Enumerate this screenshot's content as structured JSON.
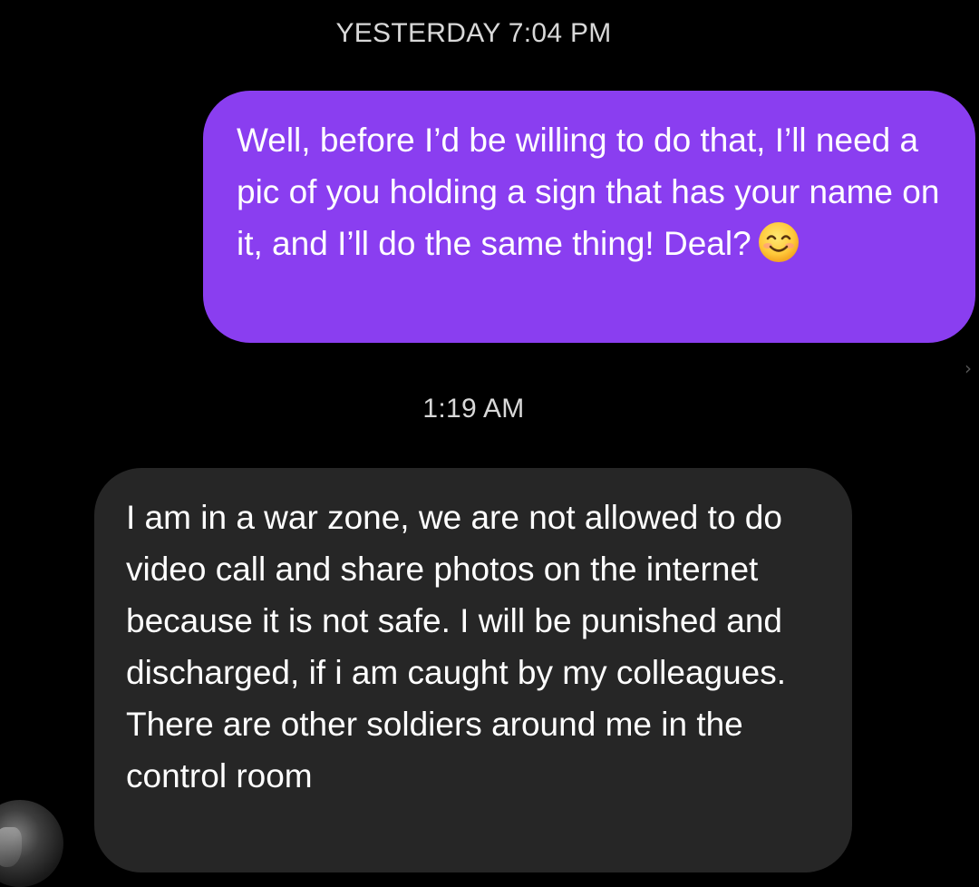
{
  "thread": {
    "timestamp_1": "YESTERDAY 7:04 PM",
    "timestamp_2": "1:19 AM"
  },
  "messages": [
    {
      "direction": "outgoing",
      "text": "Well, before I’d be willing to do that, I’ll need a pic of you holding a sign that has your name on it, and I’ll do the same thing! Deal?",
      "emoji": "smiling-face-emoji"
    },
    {
      "direction": "incoming",
      "text": "I am in a war zone, we are not allowed to do video call and share photos on the internet because it is not safe. I will be punished and discharged, if i am caught by my colleagues. There are other soldiers around me in the control room"
    }
  ],
  "icons": {
    "chevron": "chevron-right-icon",
    "avatar": "contact-avatar"
  },
  "colors": {
    "background": "#000000",
    "outgoing_bubble": "#8a3ef0",
    "incoming_bubble": "#262626",
    "timestamp_text": "#d8d8d8"
  }
}
